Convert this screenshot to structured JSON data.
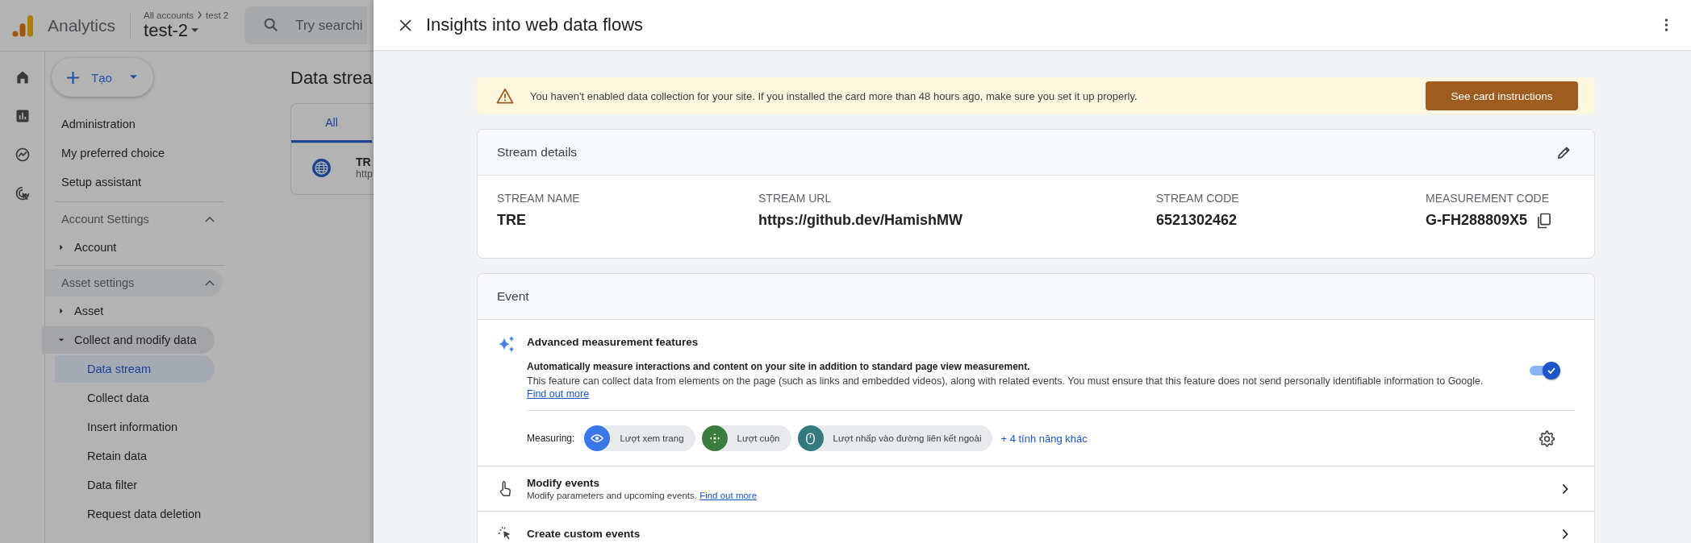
{
  "app": {
    "name": "Analytics",
    "breadcrumb": [
      "All accounts",
      "test 2"
    ],
    "property": "test-2",
    "search": {
      "placeholder": "Try searchi"
    }
  },
  "create_button": {
    "label": "Tạo"
  },
  "sidebar": {
    "top_items": [
      "Administration",
      "My preferred choice",
      "Setup assistant"
    ],
    "sections": [
      {
        "title": "Account Settings",
        "expanded": true,
        "children": [
          {
            "label": "Account",
            "expanded": false,
            "selected": false
          }
        ]
      },
      {
        "title": "Asset settings",
        "expanded": true,
        "children": [
          {
            "label": "Asset",
            "expanded": false,
            "selected": false
          },
          {
            "label": "Collect and modify data",
            "expanded": true,
            "selected": false,
            "children": [
              {
                "label": "Data stream",
                "selected": true
              },
              {
                "label": "Collect data",
                "selected": false
              },
              {
                "label": "Insert information",
                "selected": false
              },
              {
                "label": "Retain data",
                "selected": false
              },
              {
                "label": "Data filter",
                "selected": false
              },
              {
                "label": "Request data deletion",
                "selected": false
              }
            ]
          }
        ]
      }
    ]
  },
  "background_page": {
    "title": "Data strea",
    "tabs": [
      {
        "label": "All",
        "selected": true
      }
    ],
    "streams": [
      {
        "name": "TR",
        "url": "http"
      }
    ]
  },
  "panel": {
    "title": "Insights into web data flows",
    "banner": {
      "message": "You haven't enabled data collection for your site. If you installed the card more than 48 hours ago, make sure you set it up properly.",
      "button": "See card instructions"
    },
    "stream_details": {
      "title": "Stream details",
      "fields": [
        {
          "label": "STREAM NAME",
          "value": "TRE"
        },
        {
          "label": "STREAM URL",
          "value": "https://github.dev/HamishMW"
        },
        {
          "label": "STREAM CODE",
          "value": "6521302462"
        },
        {
          "label": "MEASUREMENT CODE",
          "value": "G-FH288809X5"
        }
      ]
    },
    "event": {
      "title": "Event",
      "advanced": {
        "title": "Advanced measurement features",
        "summary": "Automatically measure interactions and content on your site in addition to standard page view measurement.",
        "description": "This feature can collect data from elements on the page (such as links and embedded videos), along with related events. You must ensure that this feature does not send personally identifiable information to Google.",
        "link": "Find out more",
        "on": true,
        "measuring_label": "Measuring:",
        "chips": [
          {
            "label": "Lượt xem trang",
            "kind": "eye",
            "color": "#3b78e7"
          },
          {
            "label": "Lượt cuộn",
            "kind": "move",
            "color": "#3b7d3f"
          },
          {
            "label": "Lượt nhấp vào đường liên kết ngoài",
            "kind": "mouse",
            "color": "#327a7e"
          }
        ],
        "more": "+ 4 tính năng khác"
      },
      "rows": [
        {
          "kind": "modify",
          "title": "Modify events",
          "description": "Modify parameters and upcoming events.",
          "link": "Find out more"
        },
        {
          "kind": "custom",
          "title": "Create custom events"
        }
      ]
    }
  }
}
